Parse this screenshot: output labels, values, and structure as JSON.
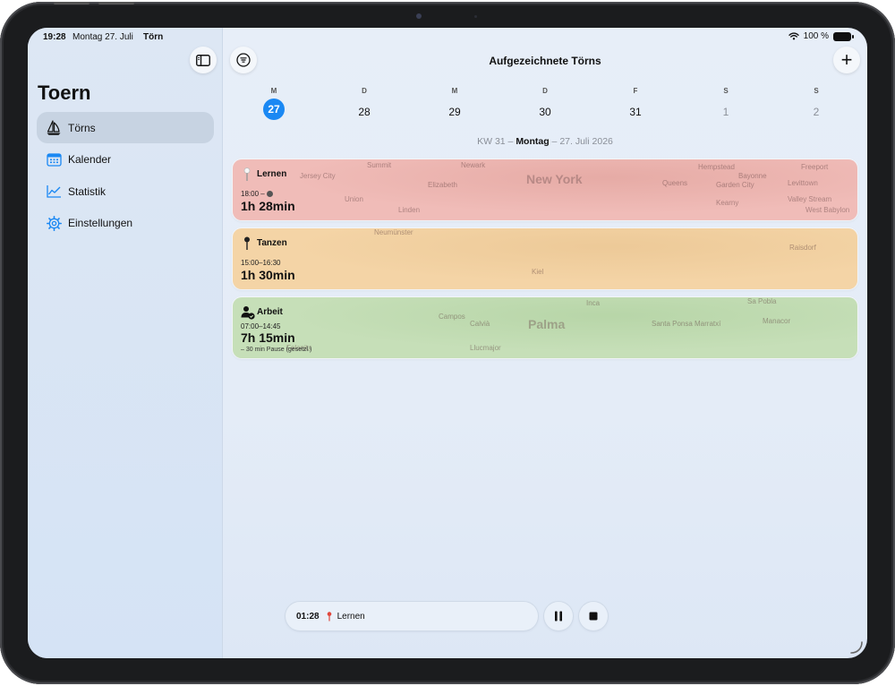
{
  "status_bar": {
    "time": "19:28",
    "date": "Montag 27. Juli",
    "app_name": "Törn",
    "battery": "100 %"
  },
  "sidebar": {
    "title": "Toern",
    "items": [
      {
        "label": "Törns",
        "icon": "sailboat-icon",
        "active": true
      },
      {
        "label": "Kalender",
        "icon": "calendar-icon",
        "active": false
      },
      {
        "label": "Statistik",
        "icon": "chart-line-icon",
        "active": false
      },
      {
        "label": "Einstellungen",
        "icon": "gear-icon",
        "active": false
      }
    ]
  },
  "header": {
    "title": "Aufgezeichnete Törns",
    "add_label": "+"
  },
  "week": {
    "days": [
      {
        "letter": "M",
        "num": "27",
        "state": "today"
      },
      {
        "letter": "D",
        "num": "28",
        "state": "normal"
      },
      {
        "letter": "M",
        "num": "29",
        "state": "normal"
      },
      {
        "letter": "D",
        "num": "30",
        "state": "normal"
      },
      {
        "letter": "F",
        "num": "31",
        "state": "normal"
      },
      {
        "letter": "S",
        "num": "1",
        "state": "muted"
      },
      {
        "letter": "S",
        "num": "2",
        "state": "muted"
      }
    ]
  },
  "date_line": {
    "week": "KW 31",
    "sep1": " – ",
    "weekday": "Montag",
    "sep2": " – ",
    "date": "27. Juli 2026"
  },
  "entries": [
    {
      "title": "Lernen",
      "time": "18:00 –",
      "duration": "1h 28min",
      "note": "",
      "color": "#f0bcb8",
      "icon": "pin-icon",
      "map_labels": [
        "Newark",
        "New York",
        "Elizabeth",
        "Hempstead",
        "Bayonne",
        "Queens",
        "Garden City",
        "Levittown",
        "Freeport",
        "Valley Stream",
        "Kearny",
        "Jersey City",
        "Union",
        "Summit",
        "West Babylon",
        "Linden"
      ]
    },
    {
      "title": "Tanzen",
      "time": "15:00–16:30",
      "duration": "1h 30min",
      "note": "",
      "color": "#f4d4a6",
      "icon": "pin-icon",
      "map_labels": [
        "Kiel",
        "Neumünster",
        "Raisdorf"
      ]
    },
    {
      "title": "Arbeit",
      "time": "07:00–14:45",
      "duration": "7h 15min",
      "note": "– 30 min Pause (gesetzl.)",
      "color": "#c6dfb8",
      "icon": "person-badge-icon",
      "map_labels": [
        "Palma",
        "Manacor",
        "Calvià",
        "Marratxí",
        "Santa Ponsa",
        "Sa Pobla",
        "Campos",
        "Llucmajor",
        "Felanitx",
        "Inca"
      ]
    }
  ],
  "player": {
    "time": "01:28",
    "label": "Lernen",
    "accent": "#e0473c"
  },
  "colors": {
    "accent": "#1a88f3"
  }
}
